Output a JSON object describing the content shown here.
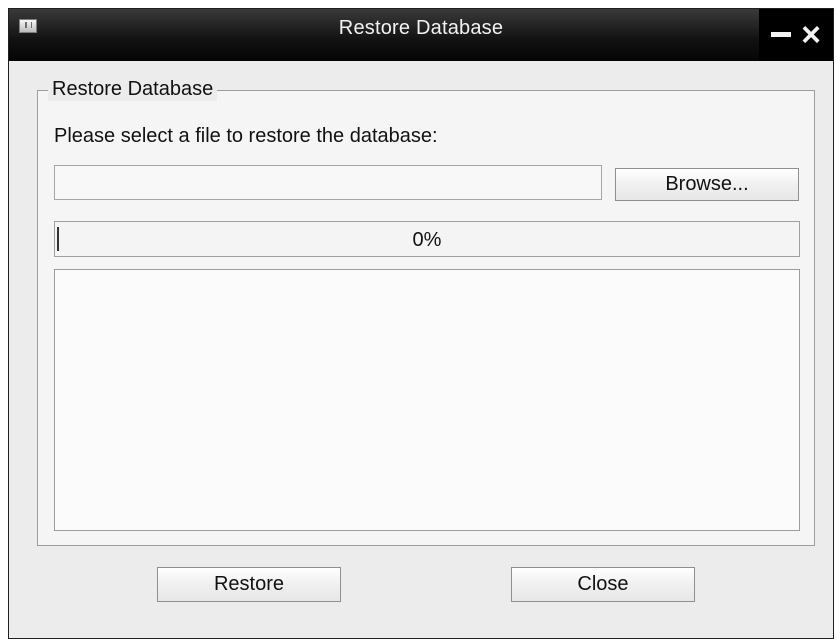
{
  "window": {
    "title": "Restore Database",
    "controls": {
      "minimize_icon": "minimize-icon",
      "close_icon": "close-icon"
    }
  },
  "group": {
    "title": "Restore Database",
    "instruction": "Please select a file to restore the database:",
    "file_input": {
      "value": "",
      "placeholder": ""
    },
    "browse_label": "Browse...",
    "progress": {
      "value": 0,
      "label": "0%"
    },
    "log_text": ""
  },
  "actions": {
    "restore_label": "Restore",
    "close_label": "Close"
  },
  "colors": {
    "titlebar": "#111111",
    "dialog_background": "#ececec",
    "border": "#9d9d9d"
  }
}
